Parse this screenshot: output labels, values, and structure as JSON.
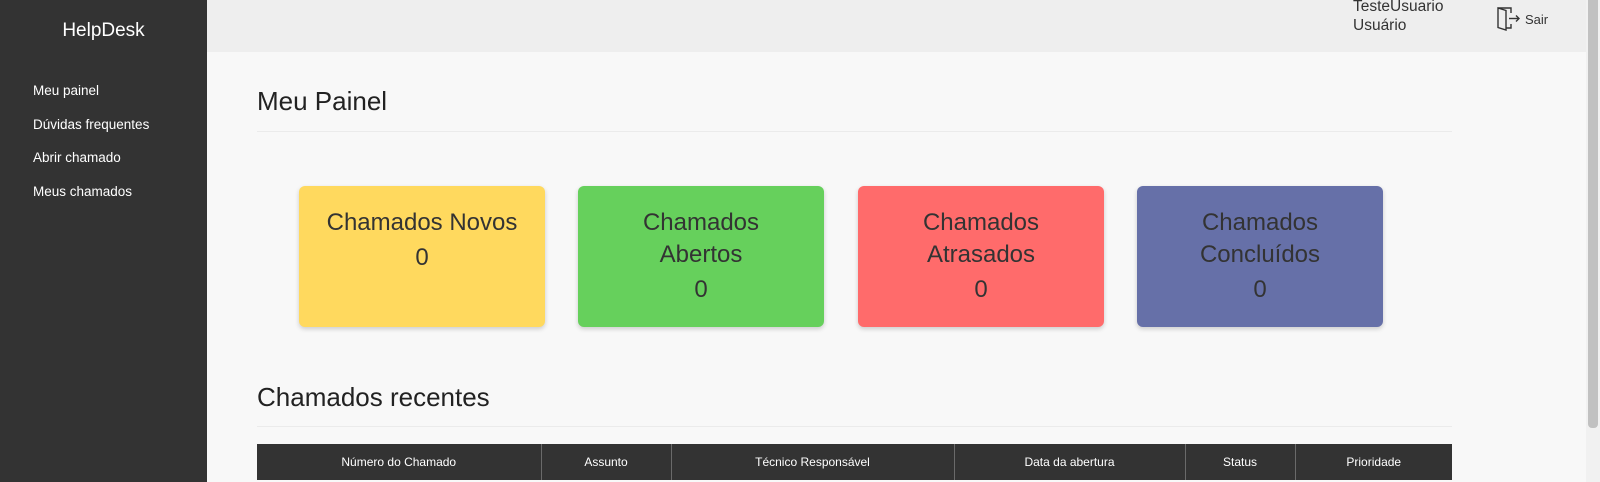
{
  "app": {
    "brand": "HelpDesk"
  },
  "sidebar": {
    "items": [
      {
        "label": "Meu painel"
      },
      {
        "label": "Dúvidas frequentes"
      },
      {
        "label": "Abrir chamado"
      },
      {
        "label": "Meus chamados"
      }
    ]
  },
  "header": {
    "user_name": "TesteUsuario",
    "user_role": "Usuário",
    "logout_label": "Sair",
    "logout_icon": "door-exit-icon"
  },
  "main": {
    "title": "Meu Painel",
    "cards": [
      {
        "line1": "Chamados",
        "line2": "Novos",
        "count": "0",
        "color": "#ffd95e"
      },
      {
        "line1": "Chamados",
        "line2": "Abertos",
        "count": "0",
        "color": "#66d05c"
      },
      {
        "line1": "Chamados",
        "line2": "Atrasados",
        "count": "0",
        "color": "#ff6b6b"
      },
      {
        "line1": "Chamados",
        "line2": "Concluídos",
        "count": "0",
        "color": "#6670a8"
      }
    ],
    "recent_title": "Chamados recentes",
    "table": {
      "headers": [
        "Número do Chamado",
        "Assunto",
        "Técnico Responsável",
        "Data da abertura",
        "Status",
        "Prioridade"
      ]
    }
  },
  "colors": {
    "sidebar_bg": "#333333",
    "topbar_bg": "#eeeeee",
    "page_bg": "#f8f8f8",
    "table_header_bg": "#333333"
  }
}
